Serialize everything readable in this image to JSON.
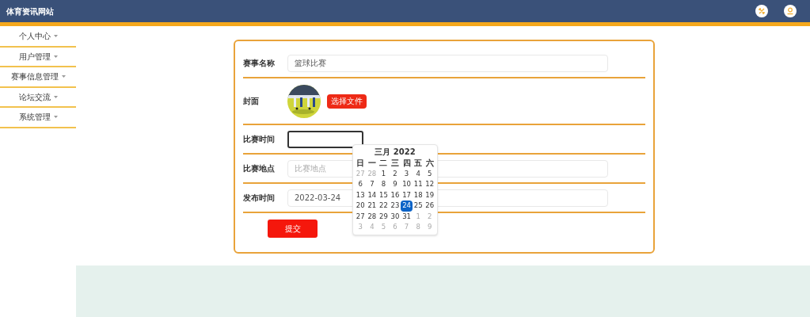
{
  "header": {
    "title": "体育资讯网站"
  },
  "sidebar": {
    "items": [
      {
        "label": "个人中心"
      },
      {
        "label": "用户管理"
      },
      {
        "label": "赛事信息管理"
      },
      {
        "label": "论坛交流"
      },
      {
        "label": "系统管理"
      }
    ]
  },
  "form": {
    "fields": [
      {
        "kind": "text",
        "label": "赛事名称",
        "value": "篮球比赛"
      },
      {
        "label": "封面",
        "button": "选择文件"
      },
      {
        "kind": "date",
        "label": "比赛时间",
        "focused": true
      },
      {
        "kind": "text",
        "label": "比赛地点",
        "placeholder": "比赛地点"
      },
      {
        "kind": "text",
        "label": "发布时间",
        "value": "2022-03-24"
      }
    ],
    "submit": "提交"
  },
  "calendar": {
    "title": "三月 2022",
    "weekdays": [
      "日",
      "一",
      "二",
      "三",
      "四",
      "五",
      "六"
    ],
    "weeks": [
      [
        {
          "day": "27",
          "muted": true,
          "selected": false
        },
        {
          "day": "28",
          "muted": true,
          "selected": false
        },
        {
          "day": "1",
          "muted": false,
          "selected": false
        },
        {
          "day": "2",
          "muted": false,
          "selected": false
        },
        {
          "day": "3",
          "muted": false,
          "selected": false
        },
        {
          "day": "4",
          "muted": false,
          "selected": false
        },
        {
          "day": "5",
          "muted": false,
          "selected": false
        }
      ],
      [
        {
          "day": "6",
          "muted": false,
          "selected": false
        },
        {
          "day": "7",
          "muted": false,
          "selected": false
        },
        {
          "day": "8",
          "muted": false,
          "selected": false
        },
        {
          "day": "9",
          "muted": false,
          "selected": false
        },
        {
          "day": "10",
          "muted": false,
          "selected": false
        },
        {
          "day": "11",
          "muted": false,
          "selected": false
        },
        {
          "day": "12",
          "muted": false,
          "selected": false
        }
      ],
      [
        {
          "day": "13",
          "muted": false,
          "selected": false
        },
        {
          "day": "14",
          "muted": false,
          "selected": false
        },
        {
          "day": "15",
          "muted": false,
          "selected": false
        },
        {
          "day": "16",
          "muted": false,
          "selected": false
        },
        {
          "day": "17",
          "muted": false,
          "selected": false
        },
        {
          "day": "18",
          "muted": false,
          "selected": false
        },
        {
          "day": "19",
          "muted": false,
          "selected": false
        }
      ],
      [
        {
          "day": "20",
          "muted": false,
          "selected": false
        },
        {
          "day": "21",
          "muted": false,
          "selected": false
        },
        {
          "day": "22",
          "muted": false,
          "selected": false
        },
        {
          "day": "23",
          "muted": false,
          "selected": false
        },
        {
          "day": "24",
          "muted": false,
          "selected": true
        },
        {
          "day": "25",
          "muted": false,
          "selected": false
        },
        {
          "day": "26",
          "muted": false,
          "selected": false
        }
      ],
      [
        {
          "day": "27",
          "muted": false,
          "selected": false
        },
        {
          "day": "28",
          "muted": false,
          "selected": false
        },
        {
          "day": "29",
          "muted": false,
          "selected": false
        },
        {
          "day": "30",
          "muted": false,
          "selected": false
        },
        {
          "day": "31",
          "muted": false,
          "selected": false
        },
        {
          "day": "1",
          "muted": true,
          "selected": false
        },
        {
          "day": "2",
          "muted": true,
          "selected": false
        }
      ],
      [
        {
          "day": "3",
          "muted": true,
          "selected": false
        },
        {
          "day": "4",
          "muted": true,
          "selected": false
        },
        {
          "day": "5",
          "muted": true,
          "selected": false
        },
        {
          "day": "6",
          "muted": true,
          "selected": false
        },
        {
          "day": "7",
          "muted": true,
          "selected": false
        },
        {
          "day": "8",
          "muted": true,
          "selected": false
        },
        {
          "day": "9",
          "muted": true,
          "selected": false
        }
      ]
    ]
  }
}
